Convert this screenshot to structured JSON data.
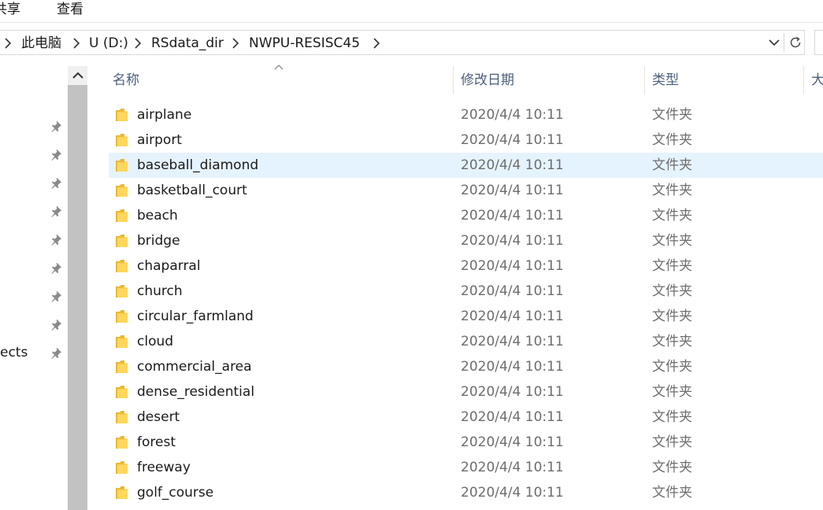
{
  "ribbon": {
    "tabs": [
      "共享",
      "查看"
    ]
  },
  "address": {
    "crumbs": [
      "此电脑",
      "U (D:)",
      "RSdata_dir",
      "NWPU-RESISC45"
    ]
  },
  "nav": {
    "partial_label": "ects",
    "pin_count": 9
  },
  "columns": {
    "name": "名称",
    "date": "修改日期",
    "type": "类型",
    "size": "大"
  },
  "rows": [
    {
      "name": "airplane",
      "date": "2020/4/4 10:11",
      "type": "文件夹"
    },
    {
      "name": "airport",
      "date": "2020/4/4 10:11",
      "type": "文件夹"
    },
    {
      "name": "baseball_diamond",
      "date": "2020/4/4 10:11",
      "type": "文件夹"
    },
    {
      "name": "basketball_court",
      "date": "2020/4/4 10:11",
      "type": "文件夹"
    },
    {
      "name": "beach",
      "date": "2020/4/4 10:11",
      "type": "文件夹"
    },
    {
      "name": "bridge",
      "date": "2020/4/4 10:11",
      "type": "文件夹"
    },
    {
      "name": "chaparral",
      "date": "2020/4/4 10:11",
      "type": "文件夹"
    },
    {
      "name": "church",
      "date": "2020/4/4 10:11",
      "type": "文件夹"
    },
    {
      "name": "circular_farmland",
      "date": "2020/4/4 10:11",
      "type": "文件夹"
    },
    {
      "name": "cloud",
      "date": "2020/4/4 10:11",
      "type": "文件夹"
    },
    {
      "name": "commercial_area",
      "date": "2020/4/4 10:11",
      "type": "文件夹"
    },
    {
      "name": "dense_residential",
      "date": "2020/4/4 10:11",
      "type": "文件夹"
    },
    {
      "name": "desert",
      "date": "2020/4/4 10:11",
      "type": "文件夹"
    },
    {
      "name": "forest",
      "date": "2020/4/4 10:11",
      "type": "文件夹"
    },
    {
      "name": "freeway",
      "date": "2020/4/4 10:11",
      "type": "文件夹"
    },
    {
      "name": "golf_course",
      "date": "2020/4/4 10:11",
      "type": "文件夹"
    }
  ],
  "selected_row": 2,
  "colors": {
    "selection": "#e5f3ff",
    "header_text": "#4c607a",
    "folder_yellow": "#ffd75e",
    "scroll_thumb": "#c2c2c2"
  },
  "icons": {
    "folder": "folder-icon",
    "pin": "pin-icon",
    "chevron": "chevron-right-icon",
    "dropdown": "chevron-down-icon",
    "refresh": "refresh-icon",
    "scroll_up": "scroll-up-arrow-icon",
    "sort": "sort-ascending-icon"
  }
}
